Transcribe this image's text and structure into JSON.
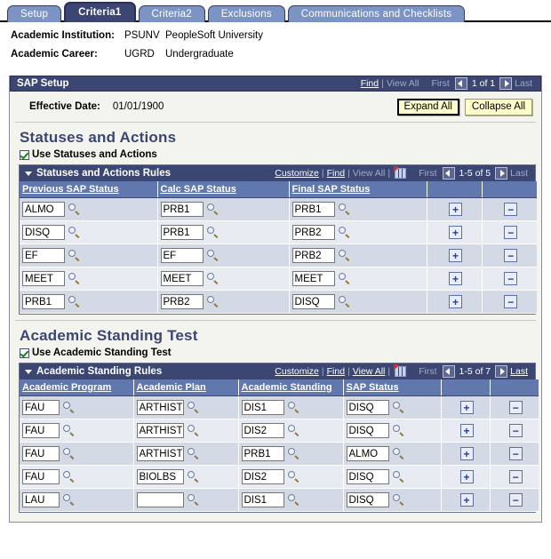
{
  "tabs": [
    {
      "label": "Setup",
      "active": false
    },
    {
      "label": "Criteria1",
      "active": true
    },
    {
      "label": "Criteria2",
      "active": false
    },
    {
      "label": "Exclusions",
      "active": false
    },
    {
      "label": "Communications and Checklists",
      "active": false
    }
  ],
  "keyfields": [
    {
      "label": "Academic Institution:",
      "code": "PSUNV",
      "desc": "PeopleSoft University"
    },
    {
      "label": "Academic Career:",
      "code": "UGRD",
      "desc": "Undergraduate"
    }
  ],
  "sap_setup": {
    "title": "SAP Setup",
    "nav": {
      "find": "Find",
      "view_all": "View All",
      "first": "First",
      "count": "1 of 1",
      "last": "Last"
    },
    "effective_date_label": "Effective Date:",
    "effective_date_value": "01/01/1900",
    "expand_all": "Expand All",
    "collapse_all": "Collapse All"
  },
  "statuses_section": {
    "title": "Statuses and Actions",
    "checkbox_label": "Use Statuses and Actions",
    "checked": true,
    "grid": {
      "title": "Statuses and Actions Rules",
      "nav": {
        "customize": "Customize",
        "find": "Find",
        "view_all": "View All",
        "first": "First",
        "count": "1-5 of 5",
        "last": "Last"
      },
      "columns": [
        "Previous SAP Status",
        "Calc SAP Status",
        "Final SAP Status"
      ],
      "rows": [
        {
          "previous": "ALMO",
          "calc": "PRB1",
          "final": "PRB1"
        },
        {
          "previous": "DISQ",
          "calc": "PRB1",
          "final": "PRB2"
        },
        {
          "previous": "EF",
          "calc": "EF",
          "final": "PRB2"
        },
        {
          "previous": "MEET",
          "calc": "MEET",
          "final": "MEET"
        },
        {
          "previous": "PRB1",
          "calc": "PRB2",
          "final": "DISQ"
        }
      ],
      "add_label": "+",
      "delete_label": "−"
    }
  },
  "standing_section": {
    "title": "Academic Standing Test",
    "checkbox_label": "Use Academic Standing Test",
    "checked": true,
    "grid": {
      "title": "Academic Standing Rules",
      "nav": {
        "customize": "Customize",
        "find": "Find",
        "view_all": "View All",
        "first": "First",
        "count": "1-5 of 7",
        "last": "Last"
      },
      "columns": [
        "Academic Program",
        "Academic Plan",
        "Academic Standing",
        "SAP Status"
      ],
      "rows": [
        {
          "program": "FAU",
          "plan": "ARTHIST",
          "standing": "DIS1",
          "sap_status": "DISQ"
        },
        {
          "program": "FAU",
          "plan": "ARTHIST",
          "standing": "DIS2",
          "sap_status": "DISQ"
        },
        {
          "program": "FAU",
          "plan": "ARTHIST",
          "standing": "PRB1",
          "sap_status": "ALMO"
        },
        {
          "program": "FAU",
          "plan": "BIOLBS",
          "standing": "DIS2",
          "sap_status": "DISQ"
        },
        {
          "program": "LAU",
          "plan": "",
          "standing": "DIS1",
          "sap_status": "DISQ"
        }
      ],
      "add_label": "+",
      "delete_label": "−"
    }
  },
  "colors": {
    "header_navy": "#3c4673",
    "tab_inactive": "#7b94c4",
    "column_header": "#6078ad",
    "row_odd": "#d4d9e6",
    "row_even": "#e8ebf2",
    "button_yellow": "#ffffcc",
    "page_bg": "#f4f4ee"
  }
}
